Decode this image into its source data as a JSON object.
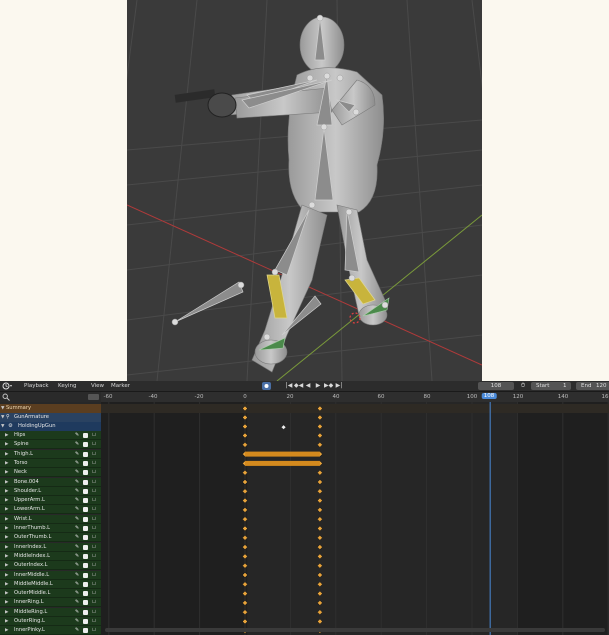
{
  "viewport": {
    "name": "3D viewport"
  },
  "header": {
    "menus": [
      "Playback",
      "Keying",
      "View",
      "Marker"
    ],
    "current_frame": "108",
    "start_label": "Start",
    "start_value": "1",
    "end_label": "End",
    "end_value": "120"
  },
  "timeline": {
    "ruler_labels": [
      "-60",
      "-40",
      "-20",
      "0",
      "20",
      "40",
      "60",
      "80",
      "100",
      "108",
      "120",
      "140",
      "16"
    ],
    "keyframes": [
      0,
      33
    ],
    "playhead": 108
  },
  "channels": {
    "summary": "Summary",
    "object": "GunArmature",
    "action": "HoldingUpGun",
    "bones": [
      "Hips",
      "Spine",
      "Thigh.L",
      "Torso",
      "Neck",
      "Bone.004",
      "Shoulder.L",
      "UpperArm.L",
      "LowerArm.L",
      "Wrist.L",
      "InnerThumb.L",
      "OuterThumb.L",
      "InnerIndex.L",
      "MiddleIndex.L",
      "OuterIndex.L",
      "InnerMiddle.L",
      "MiddleMiddle.L",
      "OuterMiddle.L",
      "InnerRing.L",
      "MiddleRing.L",
      "OuterRing.L",
      "InnerPinky.L"
    ]
  },
  "colors": {
    "keyframe": "#e8a33a",
    "hold_bar": "#d48a1e",
    "playhead": "#4a8ad9",
    "axis_x": "#b03a3a",
    "axis_y": "#7a9a3a"
  }
}
